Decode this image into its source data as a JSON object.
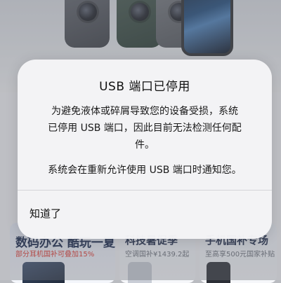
{
  "background": {
    "cards": [
      {
        "title": "数码办公 酷玩一夏",
        "subtitle": "部分耳机国补可叠加15%"
      },
      {
        "title": "科技暑促季",
        "subtitle": "空调国补¥1439.2起"
      },
      {
        "title": "手机国补专场",
        "subtitle": "至高享500元国家补贴"
      }
    ]
  },
  "alert": {
    "title": "USB 端口已停用",
    "message_lines": [
      "为避免液体或碎屑导致您的设备受损，系统",
      "已停用 USB 端口，因此目前无法检测任何配",
      "件。"
    ],
    "message_2": "系统会在重新允许使用 USB 端口时通知您。",
    "dismiss_label": "知道了"
  },
  "colors": {
    "dim_overlay": "#696c73",
    "alert_bg": "#f5f5f7",
    "card_sub_red": "#e0342b"
  }
}
